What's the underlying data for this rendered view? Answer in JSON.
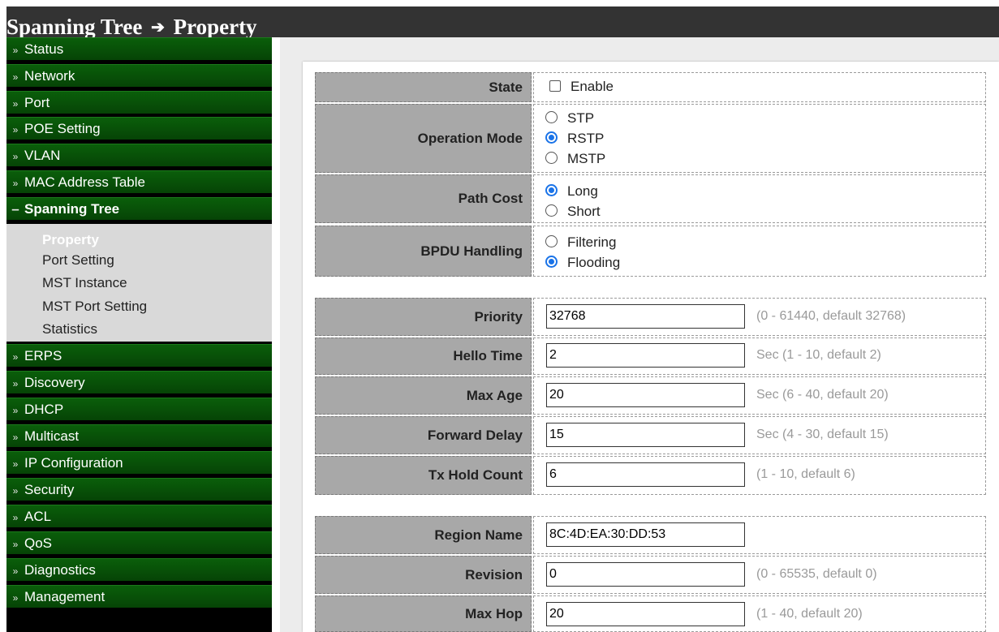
{
  "header": {
    "section": "Spanning Tree",
    "arrow": "➔",
    "page": "Property"
  },
  "sidebar": {
    "collapsed_icon": "»",
    "open_icon": "–",
    "menu_top": [
      "Status",
      "Network",
      "Port",
      "POE Setting",
      "VLAN",
      "MAC Address Table"
    ],
    "open_menu": "Spanning Tree",
    "submenu": [
      "Property",
      "Port Setting",
      "MST Instance",
      "MST Port Setting",
      "Statistics"
    ],
    "active_submenu": "Property",
    "menu_bottom": [
      "ERPS",
      "Discovery",
      "DHCP",
      "Multicast",
      "IP Configuration",
      "Security",
      "ACL",
      "QoS",
      "Diagnostics",
      "Management"
    ]
  },
  "form": {
    "state": {
      "label": "State",
      "option": "Enable",
      "checked": false
    },
    "operation_mode": {
      "label": "Operation Mode",
      "options": [
        "STP",
        "RSTP",
        "MSTP"
      ],
      "selected": "RSTP"
    },
    "path_cost": {
      "label": "Path Cost",
      "options": [
        "Long",
        "Short"
      ],
      "selected": "Long"
    },
    "bpdu_handling": {
      "label": "BPDU Handling",
      "options": [
        "Filtering",
        "Flooding"
      ],
      "selected": "Flooding"
    },
    "priority": {
      "label": "Priority",
      "value": "32768",
      "hint": "(0 - 61440, default 32768)"
    },
    "hello_time": {
      "label": "Hello Time",
      "value": "2",
      "hint": "Sec (1 - 10, default 2)"
    },
    "max_age": {
      "label": "Max Age",
      "value": "20",
      "hint": "Sec (6 - 40, default 20)"
    },
    "forward_delay": {
      "label": "Forward Delay",
      "value": "15",
      "hint": "Sec (4 - 30, default 15)"
    },
    "tx_hold_count": {
      "label": "Tx Hold Count",
      "value": "6",
      "hint": "(1 - 10, default 6)"
    },
    "region_name": {
      "label": "Region Name",
      "value": "8C:4D:EA:30:DD:53"
    },
    "revision": {
      "label": "Revision",
      "value": "0",
      "hint": "(0 - 65535, default 0)"
    },
    "max_hop": {
      "label": "Max Hop",
      "value": "20",
      "hint": "(1 - 40, default 20)"
    }
  },
  "colors": {
    "menu_green": "#0a5e0a",
    "title_bar": "#333333",
    "label_gray": "#a8a8a8",
    "radio_selected": "#1a73e8"
  }
}
